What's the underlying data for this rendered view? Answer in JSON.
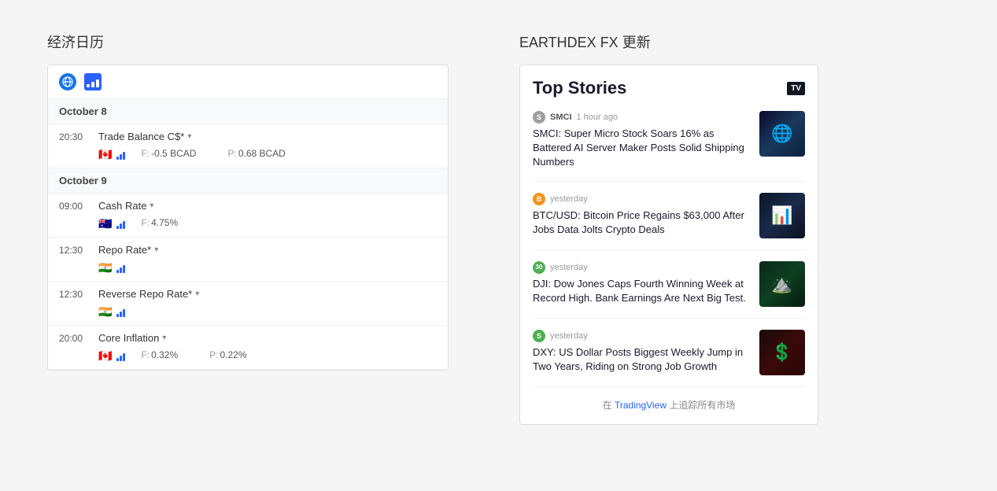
{
  "leftSection": {
    "title": "经济日历",
    "calendarDates": [
      {
        "date": "October 8",
        "events": [
          {
            "time": "20:30",
            "name": "Trade Balance C$*",
            "flag": "🇨🇦",
            "forecast": "-0.5 BCAD",
            "previous": "0.68 BCAD",
            "hasBars": true
          }
        ]
      },
      {
        "date": "October 9",
        "events": [
          {
            "time": "09:00",
            "name": "Cash Rate",
            "flag": "🇦🇺",
            "forecast": "4.75%",
            "previous": null,
            "hasBars": true
          },
          {
            "time": "12:30",
            "name": "Repo Rate*",
            "flag": "🇮🇳",
            "forecast": null,
            "previous": null,
            "hasBars": true
          },
          {
            "time": "12:30",
            "name": "Reverse Repo Rate*",
            "flag": "🇮🇳",
            "forecast": null,
            "previous": null,
            "hasBars": true
          },
          {
            "time": "20:00",
            "name": "Core Inflation",
            "flag": "🇨🇦",
            "forecast": "0.32%",
            "previous": "0.22%",
            "hasBars": true
          }
        ]
      }
    ]
  },
  "rightSection": {
    "title": "EARTHDEX FX 更新",
    "newsWidget": {
      "heading": "Top Stories",
      "tvLogo": "TV",
      "items": [
        {
          "sourceIcon": "S",
          "sourceColor": "#9e9e9e",
          "sourceName": "SMCI",
          "timeAgo": "1 hour ago",
          "headline": "SMCI: Super Micro Stock Soars 16% as Battered AI Server Maker Posts Solid Shipping Numbers",
          "thumbType": "thumb-smci",
          "thumbEmoji": "🌐"
        },
        {
          "sourceIcon": "B",
          "sourceColor": "#f7931a",
          "sourceName": "",
          "timeAgo": "yesterday",
          "headline": "BTC/USD: Bitcoin Price Regains $63,000 After Jobs Data Jolts Crypto Deals",
          "thumbType": "thumb-btc",
          "thumbEmoji": "📈"
        },
        {
          "sourceIcon": "30",
          "sourceColor": "#4caf50",
          "sourceName": "",
          "timeAgo": "yesterday",
          "headline": "DJI: Dow Jones Caps Fourth Winning Week at Record High. Bank Earnings Are Next Big Test.",
          "thumbType": "thumb-dji",
          "thumbEmoji": "⛰️"
        },
        {
          "sourceIcon": "S",
          "sourceColor": "#4caf50",
          "sourceName": "",
          "timeAgo": "yesterday",
          "headline": "DXY: US Dollar Posts Biggest Weekly Jump in Two Years, Riding on Strong Job Growth",
          "thumbType": "thumb-dxy",
          "thumbEmoji": "💲"
        }
      ],
      "footerText": "在 TradingView 上追踪所有市场",
      "footerLinkText": "TradingView",
      "footerLinkUrl": "#"
    }
  }
}
